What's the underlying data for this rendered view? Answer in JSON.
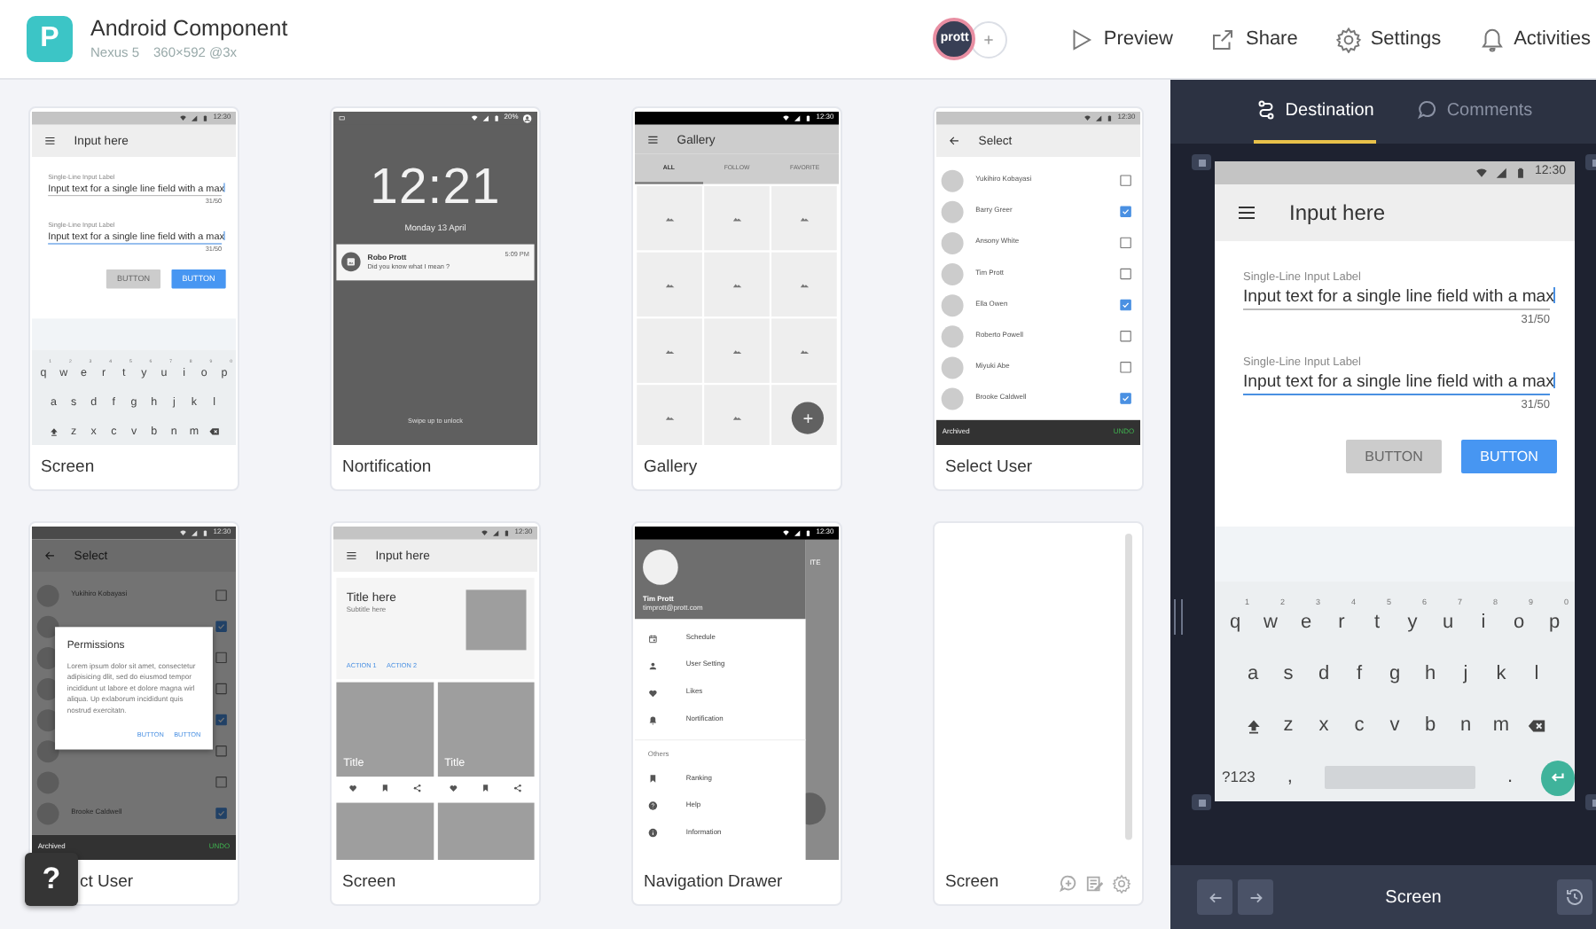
{
  "header": {
    "logo": "P",
    "title": "Android Component",
    "device": "Nexus 5",
    "resolution": "360×592 @3x",
    "avatar": "prott",
    "actions": [
      {
        "kind": "preview",
        "label": "Preview"
      },
      {
        "kind": "share",
        "label": "Share"
      },
      {
        "kind": "settings",
        "label": "Settings"
      },
      {
        "kind": "activities",
        "label": "Activities"
      }
    ]
  },
  "screens": [
    {
      "kind": "form",
      "label": "Screen",
      "status_time": "12:30",
      "title": "Input here",
      "fields": [
        {
          "label": "Single-Line Input Label",
          "value": "Input text for a single line field with a max",
          "counter": "31/50",
          "focused": false
        },
        {
          "label": "Single-Line Input Label",
          "value": "Input text for a single line field with a max",
          "counter": "31/50",
          "focused": true
        }
      ],
      "buttons": [
        {
          "label": "BUTTON",
          "disabled": true
        },
        {
          "label": "BUTTON",
          "disabled": false
        }
      ],
      "keyboard": [
        [
          {
            "kind": "char",
            "label": "q",
            "hint": "1"
          },
          {
            "kind": "char",
            "label": "w",
            "hint": "2"
          },
          {
            "kind": "char",
            "label": "e",
            "hint": "3"
          },
          {
            "kind": "char",
            "label": "r",
            "hint": "4"
          },
          {
            "kind": "char",
            "label": "t",
            "hint": "5"
          },
          {
            "kind": "char",
            "label": "y",
            "hint": "6"
          },
          {
            "kind": "char",
            "label": "u",
            "hint": "7"
          },
          {
            "kind": "char",
            "label": "i",
            "hint": "8"
          },
          {
            "kind": "char",
            "label": "o",
            "hint": "9"
          },
          {
            "kind": "char",
            "label": "p",
            "hint": "0"
          }
        ],
        [
          {
            "kind": "char",
            "label": "a"
          },
          {
            "kind": "char",
            "label": "s"
          },
          {
            "kind": "char",
            "label": "d"
          },
          {
            "kind": "char",
            "label": "f"
          },
          {
            "kind": "char",
            "label": "g"
          },
          {
            "kind": "char",
            "label": "h"
          },
          {
            "kind": "char",
            "label": "j"
          },
          {
            "kind": "char",
            "label": "k"
          },
          {
            "kind": "char",
            "label": "l"
          }
        ],
        [
          {
            "kind": "shift"
          },
          {
            "kind": "char",
            "label": "z"
          },
          {
            "kind": "char",
            "label": "x"
          },
          {
            "kind": "char",
            "label": "c"
          },
          {
            "kind": "char",
            "label": "v"
          },
          {
            "kind": "char",
            "label": "b"
          },
          {
            "kind": "char",
            "label": "n"
          },
          {
            "kind": "char",
            "label": "m"
          },
          {
            "kind": "backspace"
          }
        ]
      ]
    },
    {
      "kind": "lock",
      "label": "Nortification",
      "battery": "20%",
      "time": "12:21",
      "date": "Monday 13 April",
      "notification": {
        "sender": "Robo Prott",
        "message": "Did you know what I mean ?",
        "time": "5:09 PM"
      },
      "hint": "Swipe up to unlock"
    },
    {
      "kind": "gallery",
      "label": "Gallery",
      "status_time": "12:30",
      "title": "Gallery",
      "tabs": [
        {
          "label": "ALL",
          "selected": true
        },
        {
          "label": "FOLLOW",
          "selected": false
        },
        {
          "label": "FAVORITE",
          "selected": false
        }
      ]
    },
    {
      "kind": "select",
      "label": "Select User",
      "status_time": "12:30",
      "title": "Select",
      "users": [
        {
          "name": "Yukihiro Kobayasi",
          "checked": false
        },
        {
          "name": "Barry Greer",
          "checked": true
        },
        {
          "name": "Ansony White",
          "checked": false
        },
        {
          "name": "Tim Prott",
          "checked": false
        },
        {
          "name": "Ella Owen",
          "checked": true
        },
        {
          "name": "Roberto Powell",
          "checked": false
        },
        {
          "name": "Miyuki Abe",
          "checked": false
        },
        {
          "name": "Brooke Caldwell",
          "checked": true
        }
      ],
      "snackbar": {
        "text": "Archived",
        "action": "UNDO"
      }
    },
    {
      "kind": "dialog",
      "label": "ct User",
      "label_covered": true,
      "status_time": "12:30",
      "title": "Select",
      "users": [
        {
          "name": "Yukihiro Kobayasi",
          "checked": false
        },
        {
          "checked": true
        },
        {
          "checked": false
        },
        {
          "checked": false
        },
        {
          "checked": true
        },
        {
          "checked": false
        },
        {
          "checked": false
        },
        {
          "name": "Brooke Caldwell",
          "checked": true
        }
      ],
      "dialog": {
        "title": "Permissions",
        "body": "Lorem ipsum dolor sit amet, consectetur adipisicing dlit, sed do eiusmod tempor incididunt ut labore et dolore magna wirl aliqua. Up exlaborum incididunt quis nostrud exercitatn.",
        "buttons": [
          "BUTTON",
          "BUTTON"
        ]
      },
      "snackbar": {
        "text": "Archived",
        "action": "UNDO"
      }
    },
    {
      "kind": "cards",
      "label": "Screen",
      "status_time": "12:30",
      "title": "Input here",
      "card": {
        "title": "Title here",
        "subtitle": "Subtitle here",
        "actions": [
          "ACTION 1",
          "ACTION 2"
        ]
      },
      "tiles": [
        {
          "kind": "titled",
          "title": "Title"
        },
        {
          "kind": "titled",
          "title": "Title"
        },
        {
          "kind": "plain"
        },
        {
          "kind": "plain"
        }
      ]
    },
    {
      "kind": "drawer",
      "label": "Navigation Drawer",
      "status_time": "12:30",
      "backdrop_text": "ITE",
      "user": {
        "name": "Tim Prott",
        "email": "timprott@prott.com"
      },
      "items": [
        {
          "kind": "calendar",
          "label": "Schedule"
        },
        {
          "kind": "person",
          "label": "User Setting"
        },
        {
          "kind": "heart",
          "label": "Likes"
        },
        {
          "kind": "bell",
          "label": "Nortification"
        }
      ],
      "section": "Others",
      "more_items": [
        {
          "kind": "bookmark",
          "label": "Ranking"
        },
        {
          "kind": "help",
          "label": "Help"
        },
        {
          "kind": "info",
          "label": "Information"
        }
      ]
    },
    {
      "kind": "blank",
      "label": "Screen"
    }
  ],
  "help_button": "?",
  "panel": {
    "tabs": [
      {
        "kind": "destination",
        "label": "Destination",
        "selected": true
      },
      {
        "kind": "comments",
        "label": "Comments",
        "selected": false
      }
    ],
    "preview": {
      "kind": "form",
      "status_time": "12:30",
      "title": "Input here",
      "fields": [
        {
          "label": "Single-Line Input Label",
          "value": "Input text for a single line field with a max",
          "counter": "31/50",
          "focused": false
        },
        {
          "label": "Single-Line Input Label",
          "value": "Input text for a single line field with a max",
          "counter": "31/50",
          "focused": true
        }
      ],
      "buttons": [
        {
          "label": "BUTTON",
          "disabled": true
        },
        {
          "label": "BUTTON",
          "disabled": false
        }
      ],
      "keyboard": [
        [
          {
            "kind": "char",
            "label": "q",
            "hint": "1"
          },
          {
            "kind": "char",
            "label": "w",
            "hint": "2"
          },
          {
            "kind": "char",
            "label": "e",
            "hint": "3"
          },
          {
            "kind": "char",
            "label": "r",
            "hint": "4"
          },
          {
            "kind": "char",
            "label": "t",
            "hint": "5"
          },
          {
            "kind": "char",
            "label": "y",
            "hint": "6"
          },
          {
            "kind": "char",
            "label": "u",
            "hint": "7"
          },
          {
            "kind": "char",
            "label": "i",
            "hint": "8"
          },
          {
            "kind": "char",
            "label": "o",
            "hint": "9"
          },
          {
            "kind": "char",
            "label": "p",
            "hint": "0"
          }
        ],
        [
          {
            "kind": "char",
            "label": "a"
          },
          {
            "kind": "char",
            "label": "s"
          },
          {
            "kind": "char",
            "label": "d"
          },
          {
            "kind": "char",
            "label": "f"
          },
          {
            "kind": "char",
            "label": "g"
          },
          {
            "kind": "char",
            "label": "h"
          },
          {
            "kind": "char",
            "label": "j"
          },
          {
            "kind": "char",
            "label": "k"
          },
          {
            "kind": "char",
            "label": "l"
          }
        ],
        [
          {
            "kind": "shift"
          },
          {
            "kind": "char",
            "label": "z"
          },
          {
            "kind": "char",
            "label": "x"
          },
          {
            "kind": "char",
            "label": "c"
          },
          {
            "kind": "char",
            "label": "v"
          },
          {
            "kind": "char",
            "label": "b"
          },
          {
            "kind": "char",
            "label": "n"
          },
          {
            "kind": "char",
            "label": "m"
          },
          {
            "kind": "backspace"
          }
        ],
        [
          {
            "kind": "char",
            "label": "?123"
          },
          {
            "kind": "char",
            "label": ","
          },
          {
            "kind": "space"
          },
          {
            "kind": "char",
            "label": "."
          },
          {
            "kind": "enter"
          }
        ]
      ]
    },
    "footer": {
      "title": "Screen"
    }
  }
}
